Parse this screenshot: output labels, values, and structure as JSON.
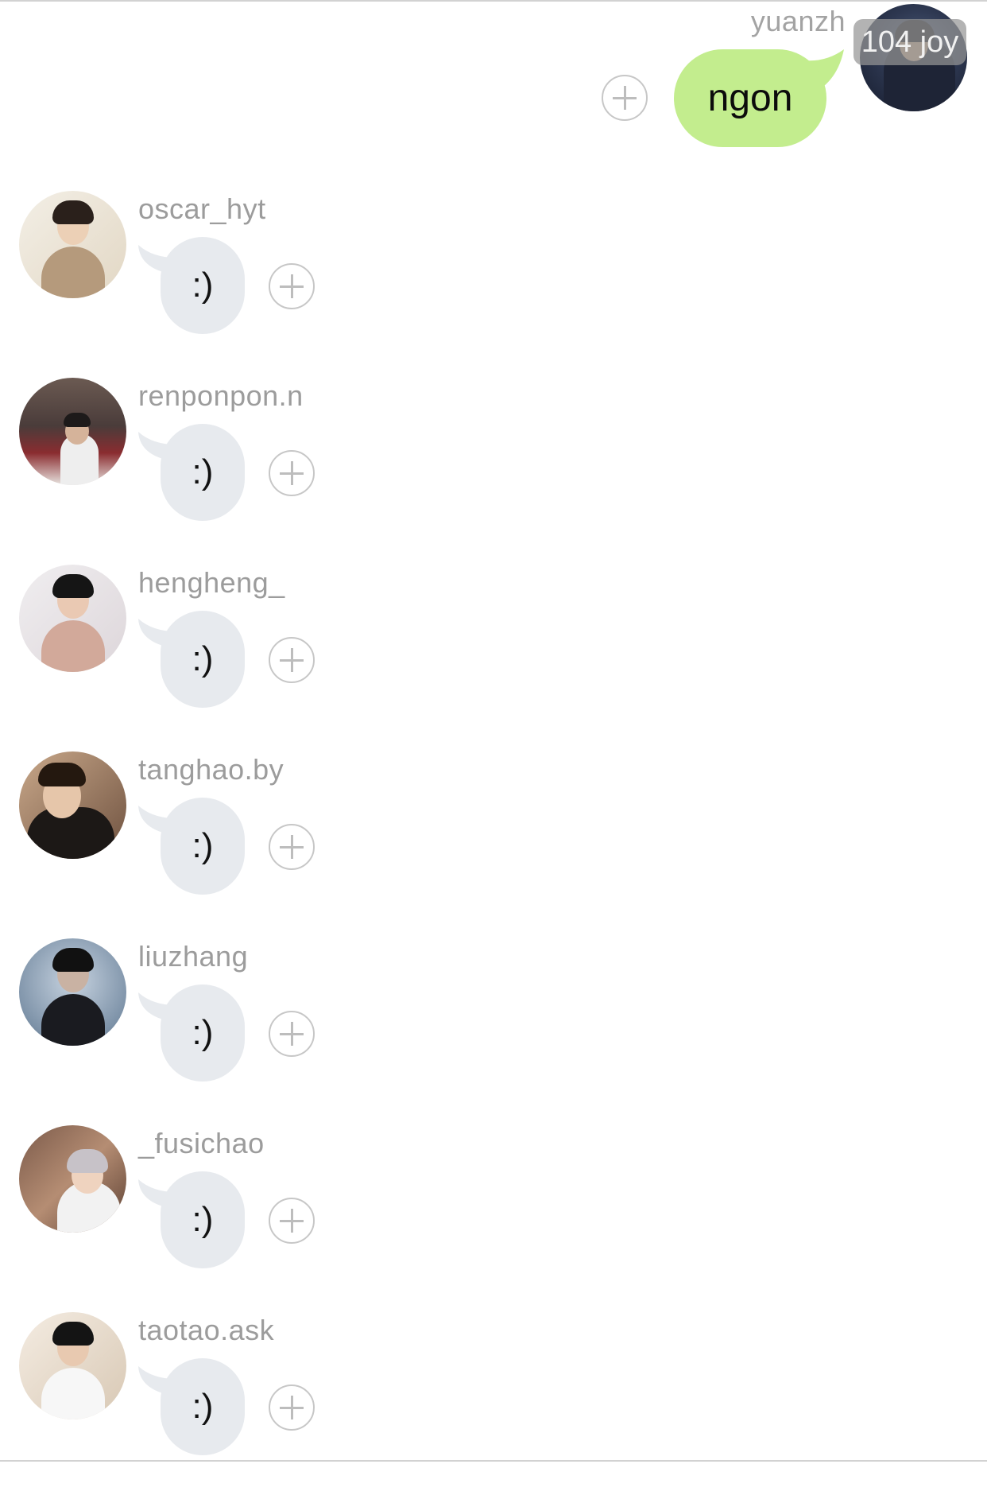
{
  "own_message": {
    "username": "yuanzh",
    "badge": "104 joy",
    "text": "ngon"
  },
  "messages": [
    {
      "username": "oscar_hyt",
      "text": ":)"
    },
    {
      "username": "renponpon.n",
      "text": ":)"
    },
    {
      "username": "hengheng_",
      "text": ":)"
    },
    {
      "username": "tanghao.by",
      "text": ":)"
    },
    {
      "username": "liuzhang",
      "text": ":)"
    },
    {
      "username": "_fusichao",
      "text": ":)"
    },
    {
      "username": "taotao.ask",
      "text": ":)"
    }
  ],
  "colors": {
    "own_bubble": "#c3ed8e",
    "incoming_bubble": "#e7eaee",
    "username_text": "#9c9c9c",
    "background": "#ffffff"
  },
  "icons": {
    "add_reaction": "plus-circle-icon"
  }
}
